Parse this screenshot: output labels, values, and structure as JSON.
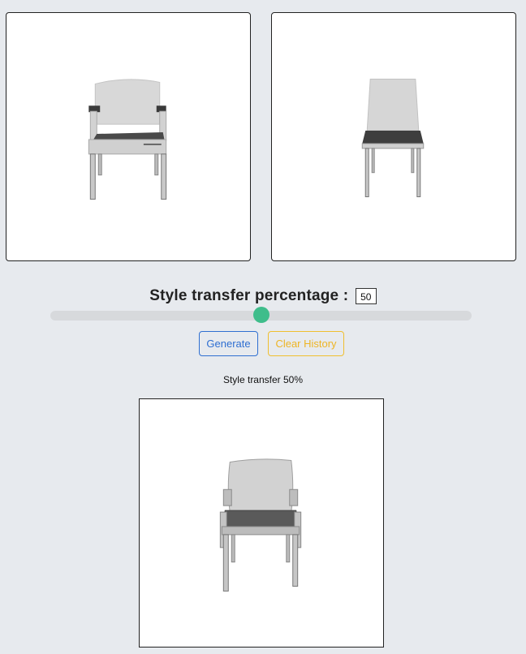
{
  "slider": {
    "label": "Style transfer percentage :",
    "value": "50",
    "fraction": 0.5
  },
  "buttons": {
    "generate": "Generate",
    "clear_history": "Clear History"
  },
  "result": {
    "caption": "Style transfer 50%"
  },
  "colors": {
    "background": "#e7eaee",
    "slider_thumb": "#3fbd8b",
    "generate_button": "#2f6fd1",
    "clear_button": "#eeb525"
  }
}
